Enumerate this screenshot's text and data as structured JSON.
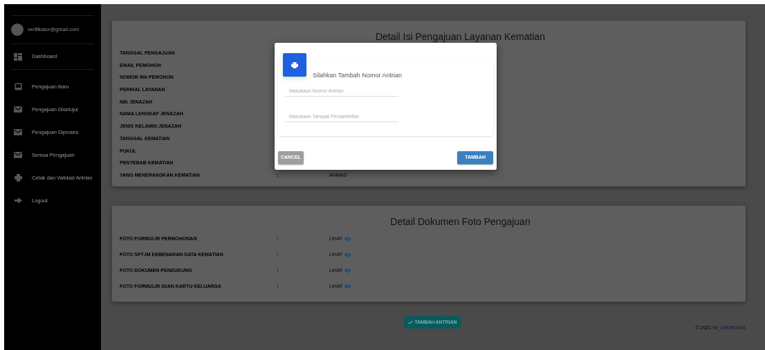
{
  "sidebar": {
    "user": {
      "email": "verifikator@gmail.com"
    },
    "items": [
      {
        "label": "Dashboard",
        "kind": "dashboard",
        "divider_after": true
      },
      {
        "label": "Pengajuan Baru",
        "kind": "inbox",
        "divider_after": false
      },
      {
        "label": "Pengajuan Disetujui",
        "kind": "mail",
        "divider_after": false
      },
      {
        "label": "Pengajuan Diproses",
        "kind": "mail",
        "divider_after": false
      },
      {
        "label": "Semua Pengajuan",
        "kind": "mail",
        "divider_after": false
      },
      {
        "label": "Cetak dan Validasi Antrian",
        "kind": "print",
        "divider_after": false
      },
      {
        "label": "Logout",
        "kind": "logout",
        "divider_after": false
      }
    ]
  },
  "detail_card": {
    "title": "Detail Isi Pengajuan Layanan Kematian",
    "rows": [
      {
        "label": "TANGGAL PENGAJUAN"
      },
      {
        "label": "EMAIL PEMOHON"
      },
      {
        "label": "NOMOR WA PEMOHON"
      },
      {
        "label": "PERIHAL LAYANAN"
      },
      {
        "label": "NIK JENAZAH"
      },
      {
        "label": "NAMA LENGKAP JENAZAH"
      },
      {
        "label": "JENIS KELAMIN JENAZAH"
      },
      {
        "label": "TANGGAL KEMATIAN"
      },
      {
        "label": "PUKUL"
      },
      {
        "label": "PENYEBAB KEMATIAN"
      },
      {
        "label": "YANG MENERANGKAN KEMATIAN",
        "separator": ":",
        "value": "AHMAD"
      }
    ]
  },
  "documents_card": {
    "title": "Detail Dokumen Foto Pengajuan",
    "rows": [
      {
        "label": "FOTO FORMULIR PERMOHONAN",
        "separator": ":",
        "link": "LIHAT"
      },
      {
        "label": "FOTO SPTJM KEBENARAN DATA KEMATIAN",
        "separator": ":",
        "link": "LIHAT"
      },
      {
        "label": "FOTO DOKUMEN PENDUKUNG",
        "separator": ":",
        "link": "LIHAT"
      },
      {
        "label": "FOTO FORMULIR ISIAN KARTU KELUARGA",
        "separator": ":",
        "link": "LIHAT"
      }
    ]
  },
  "action_button": {
    "label": "TAMBAH ANTRIAN"
  },
  "footer": {
    "copyright": "© 2021",
    "brand": "MI_UNDIKSHA"
  },
  "modal": {
    "title": "Silahkan Tambah Nomor Antrian",
    "fields": [
      {
        "placeholder": "Masukkan Nomor Antrian"
      },
      {
        "placeholder": "Masukkan Tanggal Pengambilan"
      }
    ],
    "buttons": [
      {
        "label": "CANCEL",
        "kind": "cancel"
      },
      {
        "label": "TAMBAH",
        "kind": "primary"
      }
    ]
  }
}
